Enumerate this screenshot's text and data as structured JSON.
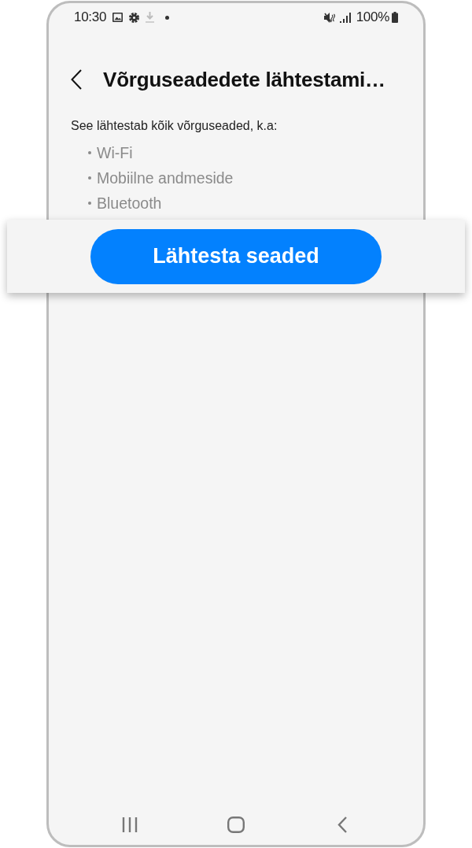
{
  "status_bar": {
    "time": "10:30",
    "battery": "100%"
  },
  "header": {
    "title": "Võrguseadedete lähtestami…"
  },
  "description": "See lähtestab kõik võrguseaded, k.a:",
  "items": [
    "Wi-Fi",
    "Mobiilne andmeside",
    "Bluetooth"
  ],
  "action_button": {
    "label": "Lähtesta seaded"
  }
}
